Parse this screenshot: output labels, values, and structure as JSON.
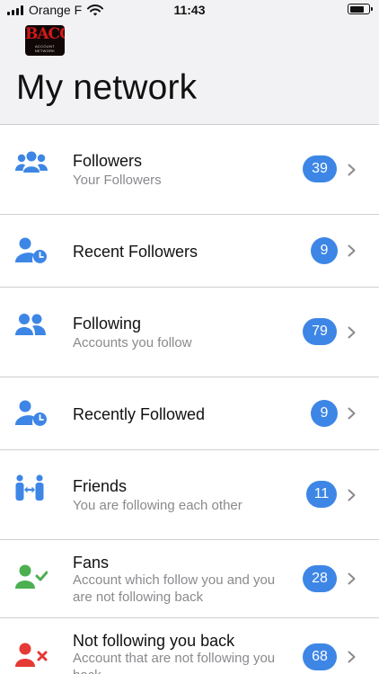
{
  "status": {
    "carrier": "Orange F",
    "time": "11:43"
  },
  "logo": {
    "main": "BACCA",
    "sub": "ACCOUNT NETWORK"
  },
  "page_title": "My network",
  "items": [
    {
      "title": "Followers",
      "subtitle": "Your Followers",
      "count": "39",
      "icon": "users-group-icon"
    },
    {
      "title": "Recent Followers",
      "subtitle": "",
      "count": "9",
      "icon": "user-clock-icon"
    },
    {
      "title": "Following",
      "subtitle": "Accounts you follow",
      "count": "79",
      "icon": "users-icon"
    },
    {
      "title": "Recently Followed",
      "subtitle": "",
      "count": "9",
      "icon": "user-clock-icon"
    },
    {
      "title": "Friends",
      "subtitle": "You are following each other",
      "count": "11",
      "icon": "people-arrows-icon"
    },
    {
      "title": "Fans",
      "subtitle": "Account which follow you and you are not following back",
      "count": "28",
      "icon": "user-check-icon"
    },
    {
      "title": "Not following you back",
      "subtitle": "Account that are not following you back",
      "count": "68",
      "icon": "user-x-icon"
    }
  ],
  "colors": {
    "accent": "#3d86e6",
    "fans_icon": "#4caf50",
    "not_following_icon": "#e53935"
  }
}
